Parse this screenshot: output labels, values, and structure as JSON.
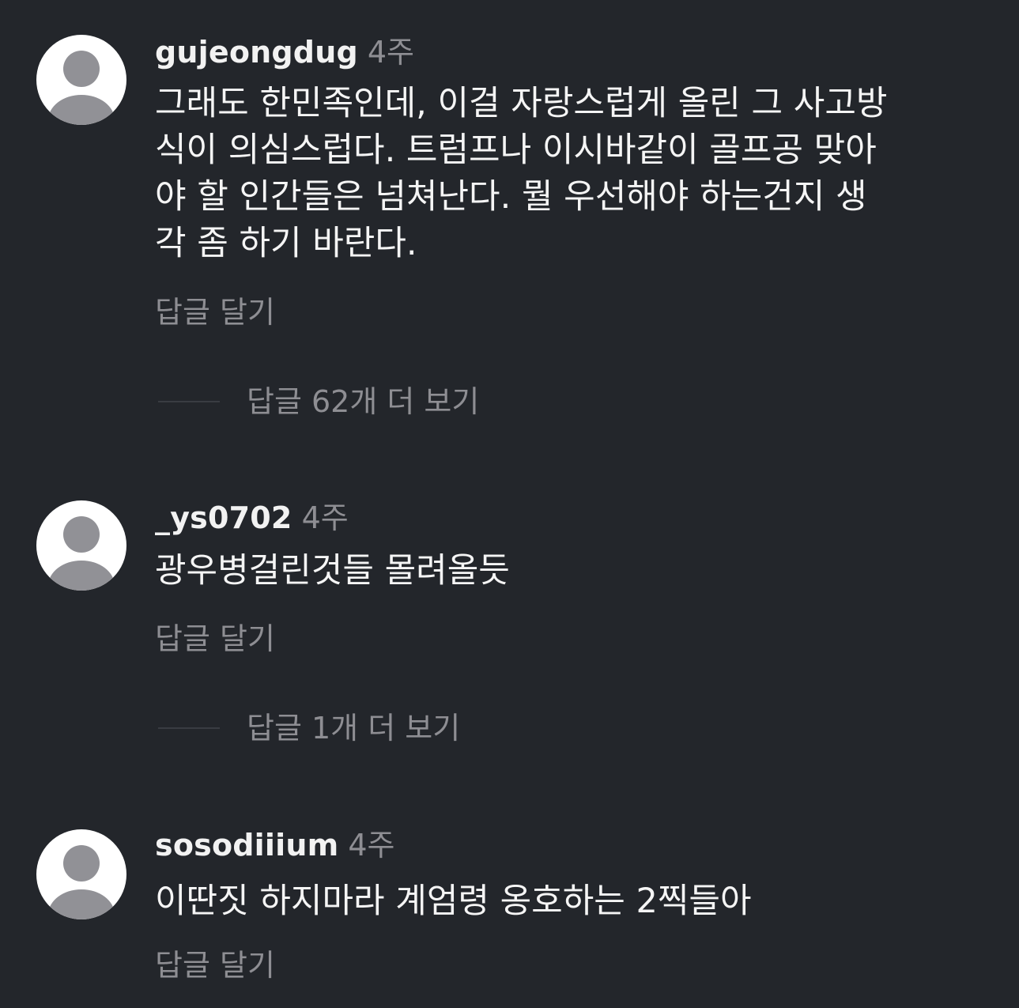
{
  "comments": [
    {
      "username": "gujeongdug",
      "time": "4주",
      "lines": [
        "그래도 한민족인데, 이걸 자랑스럽게 올린 그 사고방",
        "식이 의심스럽다. 트럼프나 이시바같이 골프공 맞아",
        "야 할 인간들은 넘쳐난다. 뭘 우선해야 하는건지 생",
        "각 좀 하기 바란다."
      ],
      "reply_label": "답글 달기",
      "more_replies_label": "답글 62개 더 보기"
    },
    {
      "username": "_ys0702",
      "time": "4주",
      "lines": [
        "광우병걸린것들 몰려올듯"
      ],
      "reply_label": "답글 달기",
      "more_replies_label": "답글 1개 더 보기"
    },
    {
      "username": "sosodiiium",
      "time": "4주",
      "lines": [
        "이딴짓 하지마라 계엄령 옹호하는 2찍들아"
      ],
      "reply_label": "답글 달기"
    }
  ],
  "colors": {
    "background": "#23262b",
    "primary_text": "#f5f5f5",
    "secondary_text": "#8e8e93",
    "avatar_bg": "#ffffff",
    "avatar_silhouette": "#919196"
  },
  "icons": {
    "avatar": "default-user-avatar-icon"
  }
}
